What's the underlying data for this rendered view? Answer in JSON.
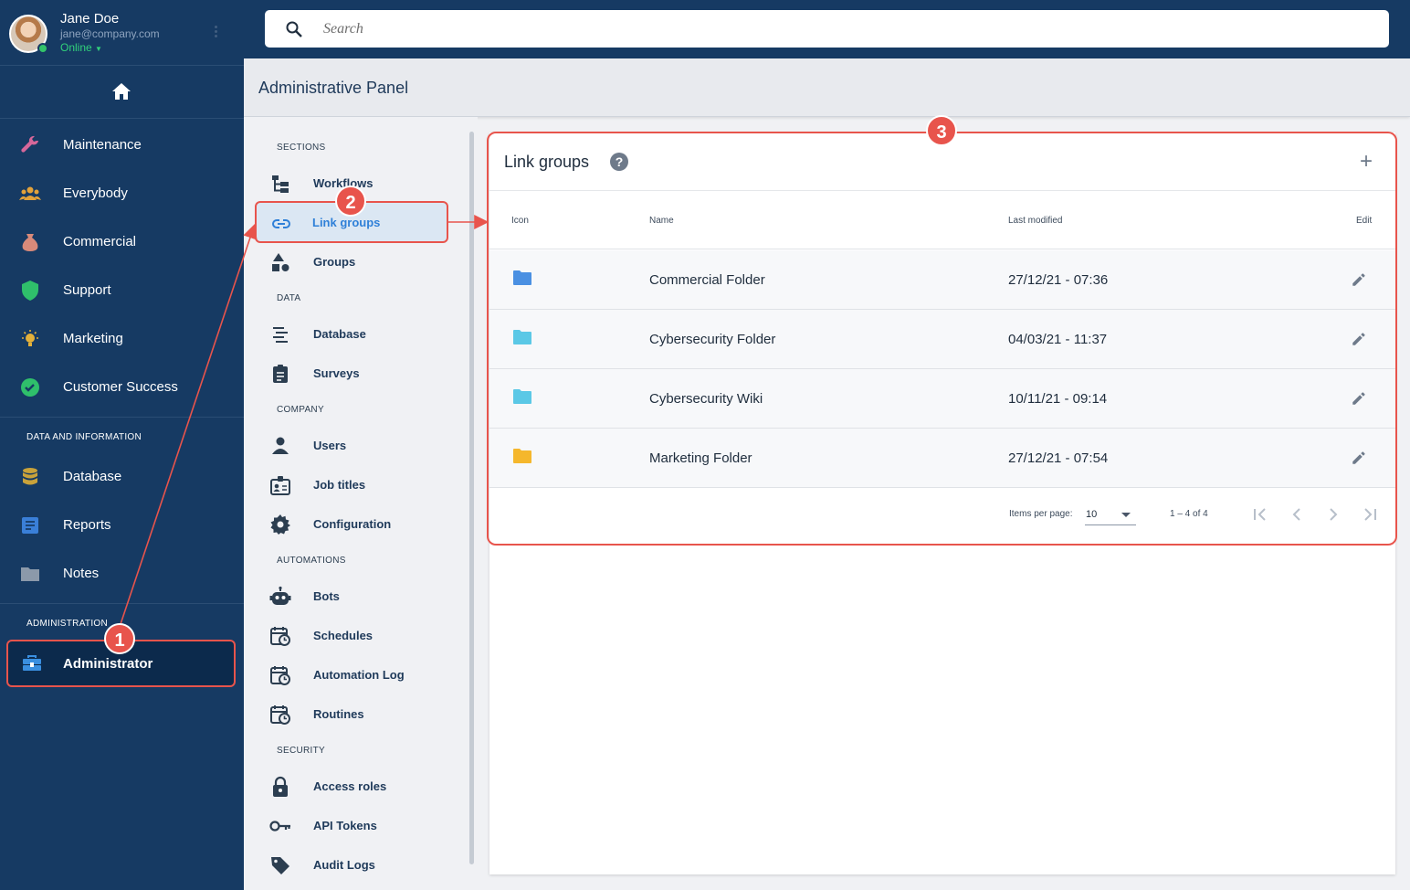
{
  "user": {
    "name": "Jane Doe",
    "email": "jane@company.com",
    "status": "Online"
  },
  "search": {
    "placeholder": "Search"
  },
  "nav": {
    "items": [
      {
        "label": "Maintenance",
        "icon": "wrench-icon"
      },
      {
        "label": "Everybody",
        "icon": "people-icon"
      },
      {
        "label": "Commercial",
        "icon": "money-bag-icon"
      },
      {
        "label": "Support",
        "icon": "shield-icon"
      },
      {
        "label": "Marketing",
        "icon": "lightbulb-icon"
      },
      {
        "label": "Customer Success",
        "icon": "check-circle-icon"
      }
    ],
    "data_section": "DATA AND INFORMATION",
    "data_items": [
      {
        "label": "Database",
        "icon": "database-icon"
      },
      {
        "label": "Reports",
        "icon": "report-icon"
      },
      {
        "label": "Notes",
        "icon": "folder-icon"
      }
    ],
    "admin_section": "ADMINISTRATION",
    "admin_item": {
      "label": "Administrator",
      "icon": "toolbox-icon"
    }
  },
  "page_title": "Administrative Panel",
  "sections_menu": {
    "groups": [
      {
        "title": "SECTIONS",
        "items": [
          {
            "label": "Workflows",
            "icon": "workflow-icon"
          },
          {
            "label": "Link groups",
            "icon": "link-icon"
          },
          {
            "label": "Groups",
            "icon": "shapes-icon"
          }
        ]
      },
      {
        "title": "DATA",
        "items": [
          {
            "label": "Database",
            "icon": "align-icon"
          },
          {
            "label": "Surveys",
            "icon": "clipboard-icon"
          }
        ]
      },
      {
        "title": "COMPANY",
        "items": [
          {
            "label": "Users",
            "icon": "person-icon"
          },
          {
            "label": "Job titles",
            "icon": "badge-icon"
          },
          {
            "label": "Configuration",
            "icon": "gear-icon"
          }
        ]
      },
      {
        "title": "AUTOMATIONS",
        "items": [
          {
            "label": "Bots",
            "icon": "robot-icon"
          },
          {
            "label": "Schedules",
            "icon": "calendar-clock-icon"
          },
          {
            "label": "Automation Log",
            "icon": "calendar-clock-icon"
          },
          {
            "label": "Routines",
            "icon": "calendar-clock-icon"
          }
        ]
      },
      {
        "title": "SECURITY",
        "items": [
          {
            "label": "Access roles",
            "icon": "lock-icon"
          },
          {
            "label": "API Tokens",
            "icon": "key-icon"
          },
          {
            "label": "Audit Logs",
            "icon": "tag-icon"
          }
        ]
      }
    ]
  },
  "panel": {
    "title": "Link groups",
    "help": "?",
    "add": "+",
    "columns": {
      "icon": "Icon",
      "name": "Name",
      "modified": "Last modified",
      "edit": "Edit"
    },
    "rows": [
      {
        "name": "Commercial Folder",
        "modified": "27/12/21 - 07:36",
        "color": "#4a90e2"
      },
      {
        "name": "Cybersecurity Folder",
        "modified": "04/03/21 - 11:37",
        "color": "#5bc8e6"
      },
      {
        "name": "Cybersecurity Wiki",
        "modified": "10/11/21 - 09:14",
        "color": "#5bc8e6"
      },
      {
        "name": "Marketing Folder",
        "modified": "27/12/21 - 07:54",
        "color": "#f5b72c"
      }
    ],
    "pager": {
      "items_per_page_label": "Items per page:",
      "items_per_page": "10",
      "range": "1 – 4 of 4"
    }
  },
  "annotations": [
    "1",
    "2",
    "3"
  ],
  "colors": {
    "nav_bg": "#163a63",
    "accent": "#2f80d8",
    "annotation": "#e8544c"
  }
}
